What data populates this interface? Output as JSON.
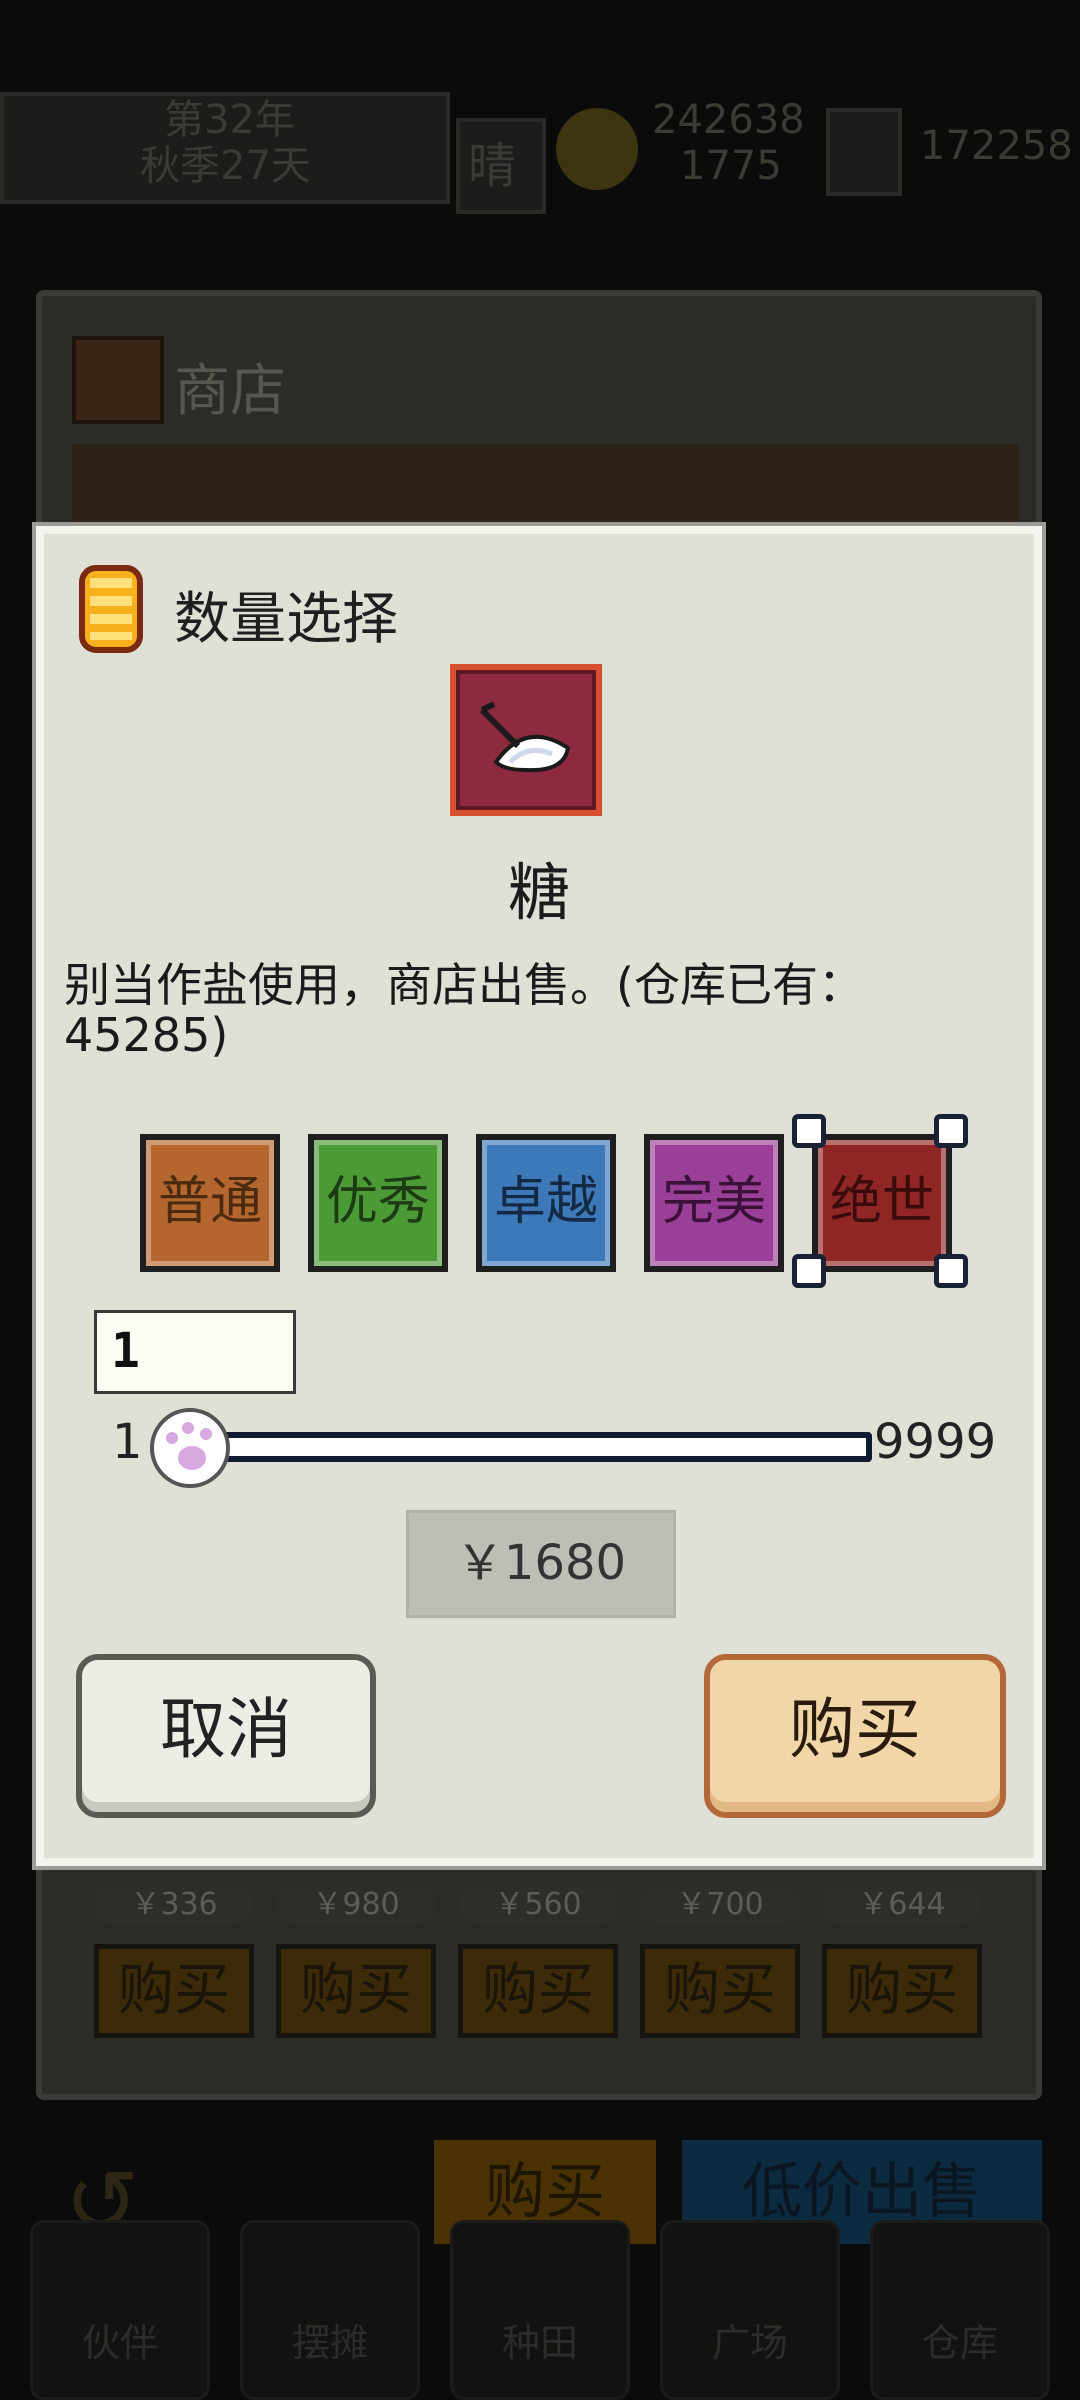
{
  "background": {
    "date_line1": "第32年",
    "date_line2": "秋季27天",
    "weather": "晴",
    "coins_line1": "242638",
    "coins_line2": "1775",
    "storage_count": "172258",
    "shop_title": "商店",
    "shop_prices": [
      "￥336",
      "￥980",
      "￥560",
      "￥700",
      "￥644"
    ],
    "shop_buy_label": "购买",
    "bottom_buy": "购买",
    "bottom_sell": "低价出售",
    "nav": [
      "伙伴",
      "摆摊",
      "种田",
      "广场",
      "仓库"
    ]
  },
  "dialog": {
    "title": "数量选择",
    "item_name": "糖",
    "item_description": "别当作盐使用，商店出售。(仓库已有：45285)",
    "qualities": [
      {
        "label": "普通",
        "color": "#b5662e",
        "text_color": "#4a2a10"
      },
      {
        "label": "优秀",
        "color": "#4c9a36",
        "text_color": "#1d3a14"
      },
      {
        "label": "卓越",
        "color": "#3d78b8",
        "text_color": "#142a44"
      },
      {
        "label": "完美",
        "color": "#9a3f98",
        "text_color": "#3a1238"
      },
      {
        "label": "绝世",
        "color": "#8f2525",
        "text_color": "#3a0b0b",
        "selected": true
      }
    ],
    "quantity_value": "1",
    "slider_min": "1",
    "slider_max": "9999",
    "slider_fraction": 0.0,
    "price_label": "￥1680",
    "cancel_label": "取消",
    "buy_label": "购买"
  }
}
